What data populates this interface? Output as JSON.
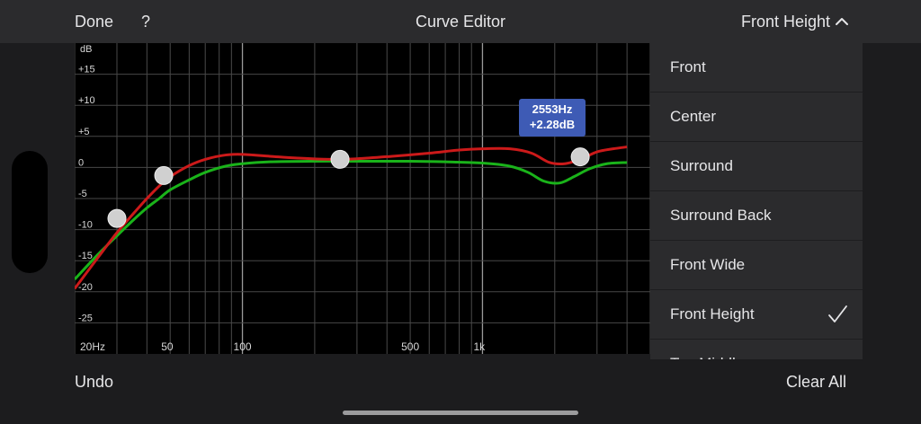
{
  "header": {
    "done_label": "Done",
    "help_label": "?",
    "title": "Curve Editor",
    "selected_channel": "Front Height",
    "selector_icon": "chevron-up-icon"
  },
  "graph": {
    "y_unit": "dB",
    "y_ticks": [
      {
        "value": 15,
        "label": "+15"
      },
      {
        "value": 10,
        "label": "+10"
      },
      {
        "value": 5,
        "label": "+5"
      },
      {
        "value": 0,
        "label": "0"
      },
      {
        "value": -5,
        "label": "-5"
      },
      {
        "value": -10,
        "label": "-10"
      },
      {
        "value": -15,
        "label": "-15"
      },
      {
        "value": -20,
        "label": "-20"
      },
      {
        "value": -25,
        "label": "-25"
      }
    ],
    "x_ticks": [
      {
        "value": 20,
        "label": "20Hz"
      },
      {
        "value": 50,
        "label": "50"
      },
      {
        "value": 100,
        "label": "100"
      },
      {
        "value": 500,
        "label": "500"
      },
      {
        "value": 1000,
        "label": "1k"
      }
    ],
    "x_range_hz": [
      20,
      5000
    ],
    "y_range_db": [
      -30,
      20
    ],
    "tooltip": {
      "freq_label": "2553Hz",
      "gain_label": "+2.28dB"
    },
    "colors": {
      "target_curve": "#cc1a1a",
      "result_curve": "#1ab31a",
      "tooltip_bg": "#3e5bb5",
      "handle": "#d0d0d0"
    },
    "red_curve": [
      {
        "hz": 20,
        "db": -19.5
      },
      {
        "hz": 25,
        "db": -14.5
      },
      {
        "hz": 30,
        "db": -10.5
      },
      {
        "hz": 35,
        "db": -7.5
      },
      {
        "hz": 40,
        "db": -5
      },
      {
        "hz": 45,
        "db": -3
      },
      {
        "hz": 50,
        "db": -1.5
      },
      {
        "hz": 60,
        "db": 0.3
      },
      {
        "hz": 70,
        "db": 1.3
      },
      {
        "hz": 85,
        "db": 2
      },
      {
        "hz": 100,
        "db": 2.1
      },
      {
        "hz": 130,
        "db": 1.8
      },
      {
        "hz": 170,
        "db": 1.5
      },
      {
        "hz": 230,
        "db": 1.3
      },
      {
        "hz": 300,
        "db": 1.4
      },
      {
        "hz": 420,
        "db": 1.8
      },
      {
        "hz": 600,
        "db": 2.3
      },
      {
        "hz": 800,
        "db": 2.8
      },
      {
        "hz": 1000,
        "db": 3
      },
      {
        "hz": 1300,
        "db": 3
      },
      {
        "hz": 1600,
        "db": 2.3
      },
      {
        "hz": 1900,
        "db": 0.8
      },
      {
        "hz": 2200,
        "db": 0.6
      },
      {
        "hz": 2553,
        "db": 1.3
      },
      {
        "hz": 3000,
        "db": 2.5
      },
      {
        "hz": 3500,
        "db": 3
      },
      {
        "hz": 4000,
        "db": 3.3
      }
    ],
    "green_curve": [
      {
        "hz": 20,
        "db": -18
      },
      {
        "hz": 25,
        "db": -14
      },
      {
        "hz": 30,
        "db": -11
      },
      {
        "hz": 35,
        "db": -8.5
      },
      {
        "hz": 40,
        "db": -6.5
      },
      {
        "hz": 45,
        "db": -5
      },
      {
        "hz": 50,
        "db": -3.6
      },
      {
        "hz": 60,
        "db": -2
      },
      {
        "hz": 70,
        "db": -0.8
      },
      {
        "hz": 85,
        "db": 0.2
      },
      {
        "hz": 100,
        "db": 0.6
      },
      {
        "hz": 130,
        "db": 0.9
      },
      {
        "hz": 200,
        "db": 1
      },
      {
        "hz": 300,
        "db": 1
      },
      {
        "hz": 500,
        "db": 1
      },
      {
        "hz": 700,
        "db": 0.9
      },
      {
        "hz": 1000,
        "db": 0.7
      },
      {
        "hz": 1300,
        "db": 0.2
      },
      {
        "hz": 1550,
        "db": -0.8
      },
      {
        "hz": 1800,
        "db": -2.2
      },
      {
        "hz": 2100,
        "db": -2.5
      },
      {
        "hz": 2400,
        "db": -1.5
      },
      {
        "hz": 2800,
        "db": -0.2
      },
      {
        "hz": 3300,
        "db": 0.6
      },
      {
        "hz": 4000,
        "db": 0.8
      }
    ],
    "handles": [
      {
        "hz": 30,
        "db": -8.2
      },
      {
        "hz": 47,
        "db": -1.3
      },
      {
        "hz": 255,
        "db": 1.3
      },
      {
        "hz": 2553,
        "db": 1.7
      }
    ]
  },
  "menu": {
    "items": [
      {
        "label": "Front",
        "selected": false
      },
      {
        "label": "Center",
        "selected": false
      },
      {
        "label": "Surround",
        "selected": false
      },
      {
        "label": "Surround Back",
        "selected": false
      },
      {
        "label": "Front Wide",
        "selected": false
      },
      {
        "label": "Front Height",
        "selected": true
      },
      {
        "label": "Top Middle",
        "selected": false
      }
    ]
  },
  "footer": {
    "undo_label": "Undo",
    "clear_label": "Clear All"
  }
}
